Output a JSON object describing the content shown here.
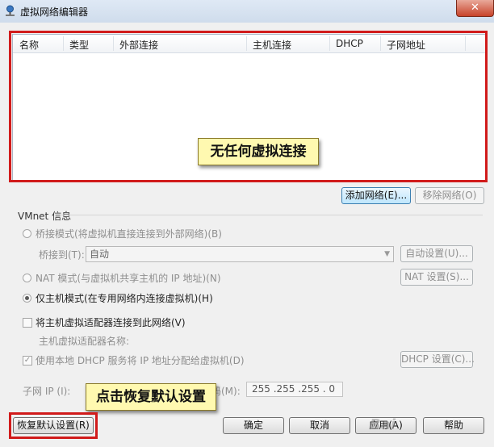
{
  "window": {
    "title": "虚拟网络编辑器",
    "close_glyph": "✕"
  },
  "table": {
    "columns": [
      "名称",
      "类型",
      "外部连接",
      "主机连接",
      "DHCP",
      "子网地址"
    ],
    "empty_message": "无任何虚拟连接"
  },
  "buttons": {
    "add_network": "添加网络(E)...",
    "remove_network": "移除网络(O)",
    "auto_settings": "自动设置(U)...",
    "nat_settings": "NAT 设置(S)...",
    "dhcp_settings": "DHCP 设置(C)...",
    "restore_defaults": "恢复默认设置(R)",
    "ok": "确定",
    "cancel": "取消",
    "apply": "应用(A)",
    "help": "帮助"
  },
  "vmnet": {
    "group_label": "VMnet 信息",
    "bridge_mode": "桥接模式(将虚拟机直接连接到外部网络)(B)",
    "bridge_to_label": "桥接到(T):",
    "bridge_to_value": "自动",
    "nat_mode": "NAT 模式(与虚拟机共享主机的 IP 地址)(N)",
    "host_only_mode": "仅主机模式(在专用网络内连接虚拟机)(H)",
    "connect_adapter": "将主机虚拟适配器连接到此网络(V)",
    "adapter_name_label": "主机虚拟适配器名称:",
    "use_dhcp": "使用本地 DHCP 服务将 IP 地址分配给虚拟机(D)",
    "subnet_ip_label": "子网 IP (I):",
    "mask_label_fragment": "码(M):",
    "mask_value": "255 .255 .255 . 0"
  },
  "callouts": {
    "restore_hint": "点击恢复默认设置"
  },
  "watermark": "Bai"
}
